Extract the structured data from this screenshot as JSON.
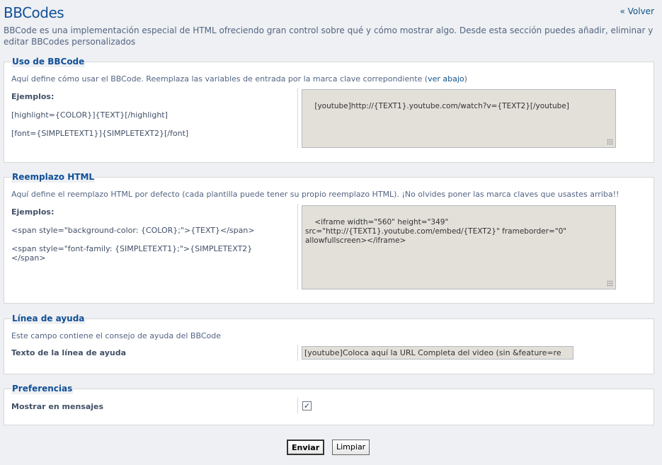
{
  "header": {
    "title": "BBCodes",
    "back_link": "« Volver",
    "intro": "BBCode es una implementación especial de HTML ofreciendo gran control sobre qué y cómo mostrar algo. Desde esta sección puedes añadir, eliminar y editar BBCodes personalizados"
  },
  "usage": {
    "legend": "Uso de BBCode",
    "desc": "Aquí define cómo usar el BBCode. Reemplaza las variables de entrada por la marca clave correpondiente (",
    "desc_link": "ver abajo",
    "desc_end": ")",
    "examples_label": "Ejemplos:",
    "example1": "[highlight={COLOR}]{TEXT}[/highlight]",
    "example2": "[font={SIMPLETEXT1}]{SIMPLETEXT2}[/font]",
    "value": "[youtube]http://{TEXT1}.youtube.com/watch?v={TEXT2}[/youtube]"
  },
  "html": {
    "legend": "Reemplazo HTML",
    "desc": "Aquí define el reemplazo HTML por defecto (cada plantilla puede tener su propio reemplazo HTML). ¡No olvides poner las marca claves que usastes arriba!!",
    "examples_label": "Ejemplos:",
    "example1": "<span style=\"background-color: {COLOR};\">{TEXT}</span>",
    "example2": "<span style=\"font-family: {SIMPLETEXT1};\">{SIMPLETEXT2}</span>",
    "value": "<iframe width=\"560\" height=\"349\" src=\"http://{TEXT1}.youtube.com/embed/{TEXT2}\" frameborder=\"0\" allowfullscreen></iframe>"
  },
  "help": {
    "legend": "Línea de ayuda",
    "desc": "Este campo contiene el consejo de ayuda del BBCode",
    "label": "Texto de la línea de ayuda",
    "value": "[youtube]Coloca aquí la URL Completa del video (sin &feature=re"
  },
  "prefs": {
    "legend": "Preferencias",
    "label": "Mostrar en mensajes",
    "checked": true,
    "check_glyph": "✓"
  },
  "buttons": {
    "submit": "Enviar",
    "reset": "Limpiar"
  }
}
